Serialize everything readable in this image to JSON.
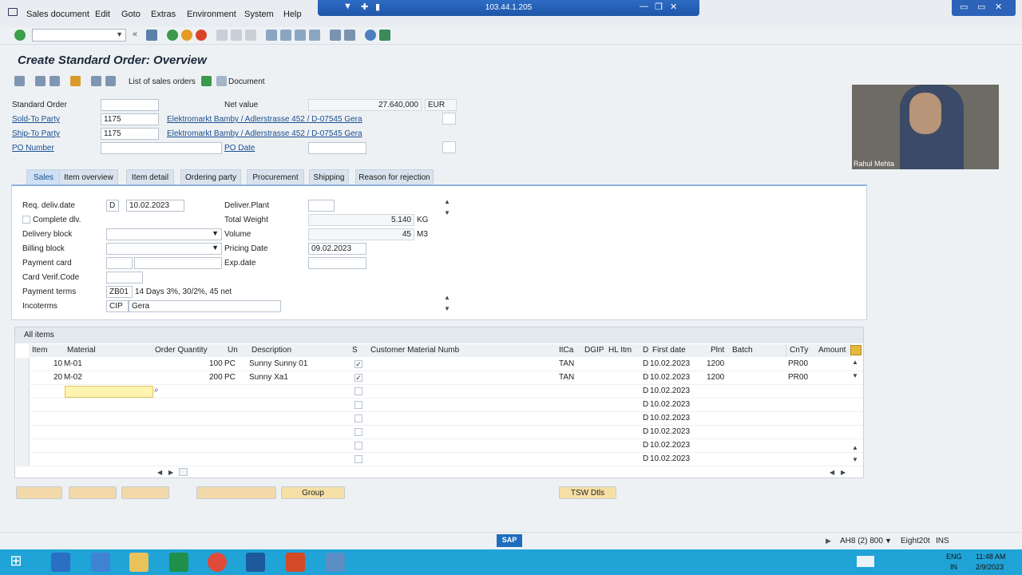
{
  "menubar": {
    "items": [
      "Sales document",
      "Edit",
      "Goto",
      "Extras",
      "Environment",
      "System",
      "Help"
    ],
    "remote_ip": "103.44.1.205"
  },
  "title": "Create Standard Order: Overview",
  "app_toolbar": {
    "list_of_sales_orders": "List of sales orders",
    "document": "Document"
  },
  "header": {
    "standard_order_label": "Standard Order",
    "standard_order_value": "",
    "net_value_label": "Net value",
    "net_value": "27.640,000",
    "currency": "EUR",
    "sold_to_label": "Sold-To Party",
    "sold_to_value": "1175",
    "sold_to_desc": "Elektromarkt Bamby / Adlerstrasse 452 / D-07545 Gera",
    "ship_to_label": "Ship-To Party",
    "ship_to_value": "1175",
    "ship_to_desc": "Elektromarkt Bamby / Adlerstrasse 452 / D-07545 Gera",
    "po_number_label": "PO Number",
    "po_number_value": "",
    "po_date_label": "PO Date",
    "po_date_value": ""
  },
  "tabs": [
    "Sales",
    "Item overview",
    "Item detail",
    "Ordering party",
    "Procurement",
    "Shipping",
    "Reason for rejection"
  ],
  "sales_tab": {
    "req_deliv_date_label": "Req. deliv.date",
    "req_deliv_date_type": "D",
    "req_deliv_date": "10.02.2023",
    "deliver_plant_label": "Deliver.Plant",
    "complete_dlv_label": "Complete dlv.",
    "total_weight_label": "Total Weight",
    "total_weight": "5.140",
    "weight_unit": "KG",
    "delivery_block_label": "Delivery block",
    "volume_label": "Volume",
    "volume": "45",
    "volume_unit": "M3",
    "billing_block_label": "Billing block",
    "pricing_date_label": "Pricing Date",
    "pricing_date": "09.02.2023",
    "payment_card_label": "Payment card",
    "exp_date_label": "Exp.date",
    "card_verif_label": "Card Verif.Code",
    "payment_terms_label": "Payment terms",
    "payment_terms_code": "ZB01",
    "payment_terms_text": "14 Days 3%, 30/2%, 45 net",
    "incoterms_label": "Incoterms",
    "incoterms_code": "CIP",
    "incoterms_place": "Gera"
  },
  "items": {
    "title": "All items",
    "columns": [
      "Item",
      "Material",
      "Order Quantity",
      "Un",
      "Description",
      "S",
      "Customer Material Numb",
      "ItCa",
      "DGIP",
      "HL Itm",
      "D",
      "First date",
      "Plnt",
      "Batch",
      "CnTy",
      "Amount"
    ],
    "rows": [
      {
        "item": "10",
        "material": "M-01",
        "qty": "100",
        "un": "PC",
        "desc": "Sunny Sunny 01",
        "itca": "TAN",
        "d": "D",
        "first_date": "10.02.2023",
        "plnt": "1200",
        "cnty": "PR00"
      },
      {
        "item": "20",
        "material": "M-02",
        "qty": "200",
        "un": "PC",
        "desc": "Sunny Xa1",
        "itca": "TAN",
        "d": "D",
        "first_date": "10.02.2023",
        "plnt": "1200",
        "cnty": "PR00"
      }
    ],
    "empty_dates": [
      "10.02.2023",
      "10.02.2023",
      "10.02.2023",
      "10.02.2023",
      "10.02.2023",
      "10.02.2023"
    ]
  },
  "bottom_buttons": {
    "group": "Group",
    "tsw": "TSW Dtls"
  },
  "webcam_name": "Rahul Mehta",
  "statusbar": {
    "system": "AH8 (2) 800",
    "server": "Eight20t",
    "mode": "INS"
  },
  "taskbar": {
    "lang": "ENG",
    "region": "IN",
    "time": "11:48 AM",
    "date": "2/9/2023"
  }
}
